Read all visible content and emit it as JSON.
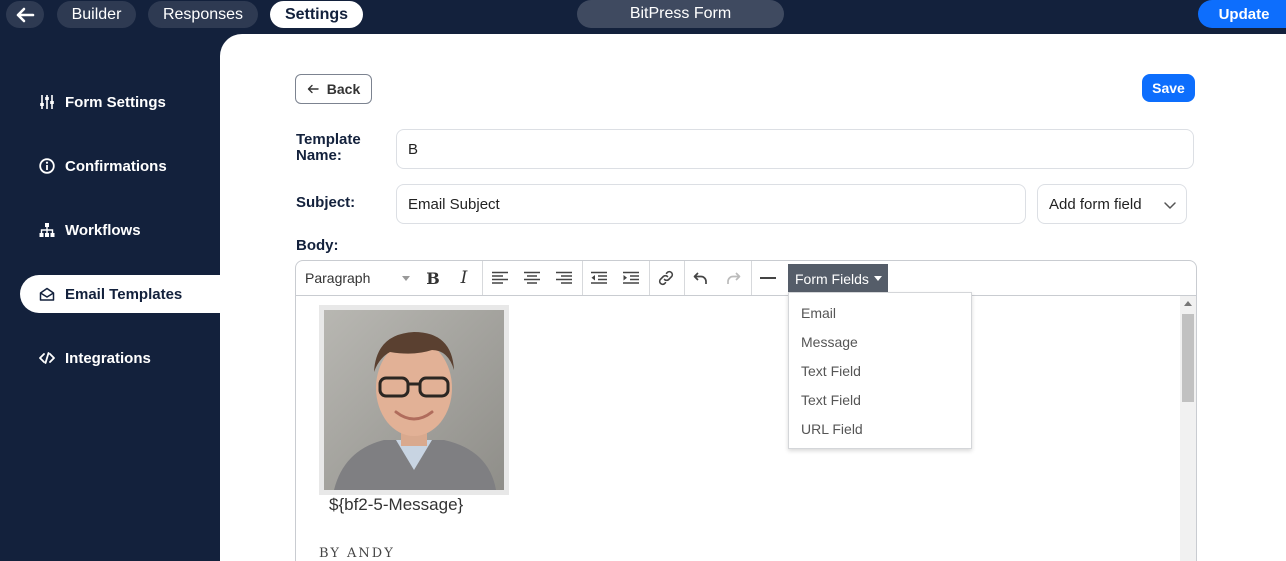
{
  "topbar": {
    "tabs": [
      {
        "label": "Builder"
      },
      {
        "label": "Responses"
      },
      {
        "label": "Settings"
      }
    ],
    "form_title": "BitPress Form",
    "update_label": "Update"
  },
  "sidebar": {
    "items": [
      {
        "label": "Form Settings",
        "icon": "sliders-icon"
      },
      {
        "label": "Confirmations",
        "icon": "info-icon"
      },
      {
        "label": "Workflows",
        "icon": "sitemap-icon"
      },
      {
        "label": "Email Templates",
        "icon": "envelope-open-icon",
        "active": true
      },
      {
        "label": "Integrations",
        "icon": "code-icon"
      }
    ]
  },
  "main": {
    "back_label": "Back",
    "save_label": "Save",
    "template_name_label": "Template Name:",
    "template_name_value": "B",
    "subject_label": "Subject:",
    "subject_value": "Email Subject",
    "add_form_field_label": "Add form field",
    "body_label": "Body:"
  },
  "editor": {
    "paragraph_label": "Paragraph",
    "form_fields_label": "Form Fields",
    "form_fields_options": [
      "Email",
      "Message",
      "Text Field",
      "Text Field",
      "URL Field"
    ],
    "content": {
      "message_token": "${bf2-5-Message}",
      "byline": "BY ANDY"
    }
  }
}
